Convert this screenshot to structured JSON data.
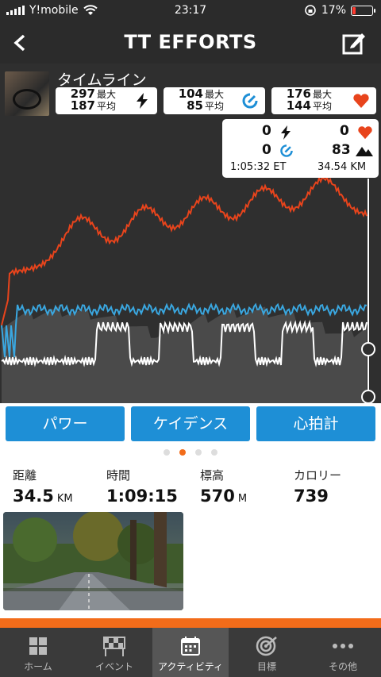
{
  "status": {
    "carrier": "Y!mobile",
    "time": "23:17",
    "battery": "17%",
    "battery_level": 0.17
  },
  "header": {
    "title": "TT EFFORTS"
  },
  "timeline": {
    "title": "タイムライン",
    "power": {
      "max": "297",
      "avg": "187",
      "max_label": "最大",
      "avg_label": "平均"
    },
    "cadence": {
      "max": "104",
      "avg": "85",
      "max_label": "最大",
      "avg_label": "平均"
    },
    "heart": {
      "max": "176",
      "avg": "144",
      "max_label": "最大",
      "avg_label": "平均"
    }
  },
  "readout": {
    "power": "0",
    "heart": "0",
    "cadence": "0",
    "elevation": "83",
    "elapsed": "1:05:32 ET",
    "distance": "34.54 KM"
  },
  "metric_buttons": [
    "パワー",
    "ケイデンス",
    "心拍計"
  ],
  "pager": {
    "count": 4,
    "active": 1
  },
  "summary": [
    {
      "label": "距離",
      "value": "34.5",
      "unit": "KM"
    },
    {
      "label": "時間",
      "value": "1:09:15",
      "unit": ""
    },
    {
      "label": "標高",
      "value": "570",
      "unit": "M"
    },
    {
      "label": "カロリー",
      "value": "739",
      "unit": ""
    }
  ],
  "tabs": [
    {
      "label": "ホーム",
      "icon": "grid-icon"
    },
    {
      "label": "イベント",
      "icon": "checkered-flag-icon"
    },
    {
      "label": "アクティビティ",
      "icon": "calendar-icon"
    },
    {
      "label": "目標",
      "icon": "target-icon"
    },
    {
      "label": "その他",
      "icon": "more-dots-icon"
    }
  ],
  "colors": {
    "accent": "#f26c1a",
    "button_blue": "#1e8fd6",
    "heart_line": "#e8441c",
    "cadence_line": "#3aa7e0",
    "power_line": "#ffffff"
  }
}
